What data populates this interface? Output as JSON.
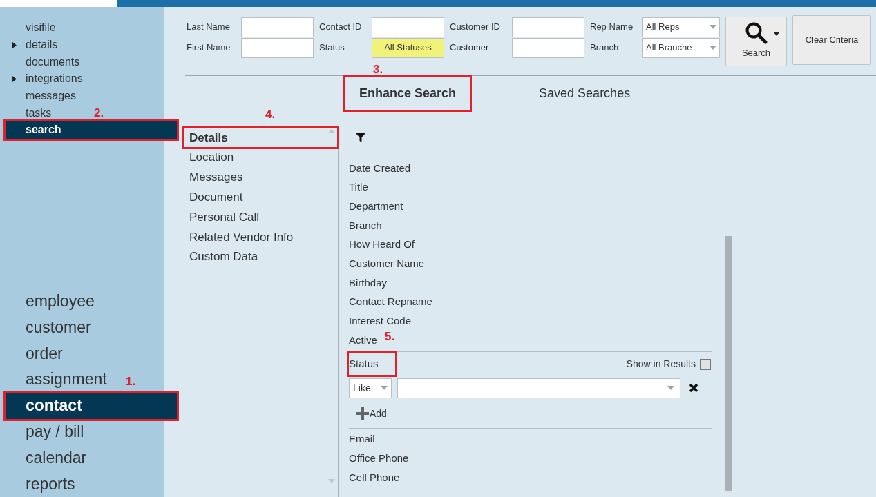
{
  "sidebar": {
    "items": [
      {
        "label": "visifile",
        "expandable": false,
        "selected": false
      },
      {
        "label": "details",
        "expandable": true,
        "selected": false
      },
      {
        "label": "documents",
        "expandable": false,
        "selected": false
      },
      {
        "label": "integrations",
        "expandable": true,
        "selected": false
      },
      {
        "label": "messages",
        "expandable": false,
        "selected": false
      },
      {
        "label": "tasks",
        "expandable": false,
        "selected": false
      },
      {
        "label": "search",
        "expandable": false,
        "selected": true,
        "callout": "2."
      }
    ],
    "modules": [
      {
        "label": "employee",
        "selected": false
      },
      {
        "label": "customer",
        "selected": false
      },
      {
        "label": "order",
        "selected": false
      },
      {
        "label": "assignment",
        "selected": false
      },
      {
        "label": "contact",
        "selected": true,
        "callout": "1."
      },
      {
        "label": "pay / bill",
        "selected": false
      },
      {
        "label": "calendar",
        "selected": false
      },
      {
        "label": "reports",
        "selected": false
      }
    ]
  },
  "criteria": [
    [
      {
        "label": "Last Name",
        "kind": "text"
      },
      {
        "label": "First Name",
        "kind": "text"
      }
    ],
    [
      {
        "label": "Contact ID",
        "kind": "text"
      },
      {
        "label": "Status",
        "kind": "highlight",
        "value": "All Statuses"
      }
    ],
    [
      {
        "label": "Customer ID",
        "kind": "text"
      },
      {
        "label": "Customer",
        "kind": "text"
      }
    ],
    [
      {
        "label": "Rep Name",
        "kind": "select",
        "value": "All Reps"
      },
      {
        "label": "Branch",
        "kind": "select",
        "value": "All Branche"
      }
    ]
  ],
  "search_button": {
    "label": "Search"
  },
  "clear_button": {
    "label": "Clear Criteria"
  },
  "tabs": [
    {
      "label": "Enhance Search",
      "selected": true,
      "callout": "3."
    },
    {
      "label": "Saved Searches",
      "selected": false
    }
  ],
  "categories": [
    {
      "label": "Details",
      "selected": true,
      "callout": "4."
    },
    {
      "label": "Location",
      "selected": false
    },
    {
      "label": "Messages",
      "selected": false
    },
    {
      "label": "Document",
      "selected": false
    },
    {
      "label": "Personal Call",
      "selected": false
    },
    {
      "label": "Related Vendor Info",
      "selected": false
    },
    {
      "label": "Custom Data",
      "selected": false
    }
  ],
  "fields": [
    {
      "label": "Date Created",
      "expanded": false
    },
    {
      "label": "Title",
      "expanded": false
    },
    {
      "label": "Department",
      "expanded": false
    },
    {
      "label": "Branch",
      "expanded": false
    },
    {
      "label": "How Heard Of",
      "expanded": false
    },
    {
      "label": "Customer Name",
      "expanded": false
    },
    {
      "label": "Birthday",
      "expanded": false
    },
    {
      "label": "Contact Repname",
      "expanded": false
    },
    {
      "label": "Interest Code",
      "expanded": false
    },
    {
      "label": "Active",
      "expanded": false,
      "callout": "5."
    },
    {
      "label": "Status",
      "expanded": true,
      "callout_box": true,
      "show_in_results_label": "Show in Results",
      "show_in_results": false,
      "operator": "Like",
      "add_label": "Add"
    },
    {
      "label": "Email",
      "expanded": false
    },
    {
      "label": "Office Phone",
      "expanded": false
    },
    {
      "label": "Cell Phone",
      "expanded": false
    }
  ]
}
